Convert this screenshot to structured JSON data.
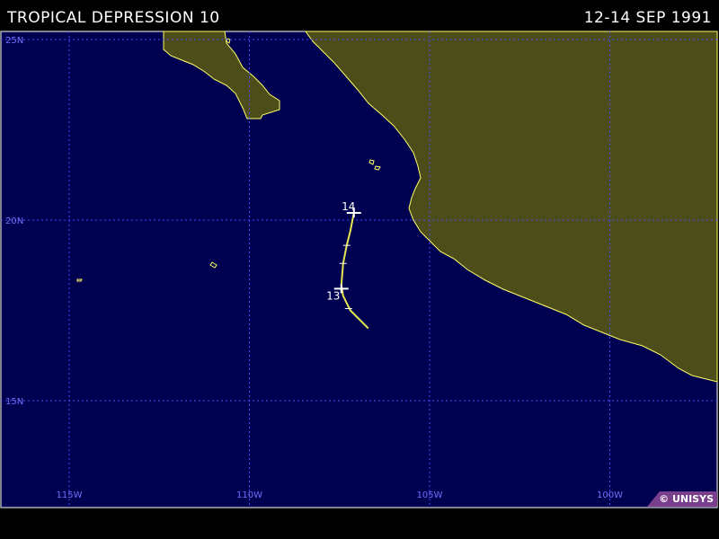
{
  "title_left": "TROPICAL DEPRESSION 10",
  "title_right": "12-14 SEP 1991",
  "credit": "© UNISYS",
  "colors": {
    "ocean": "#000050",
    "land": "#4d4d1a",
    "coastline": "#ffff66",
    "grid": "#4a4aff",
    "grid_labels": "#6f6fff",
    "track": "#e6e650",
    "marker": "#ffffff"
  },
  "map": {
    "lon_range": [
      -117,
      -97
    ],
    "lat_range": [
      10.5,
      25.3
    ],
    "gridlines": {
      "longitudes": [
        {
          "lon": -115,
          "label": "115W"
        },
        {
          "lon": -110,
          "label": "110W"
        },
        {
          "lon": -105,
          "label": "105W"
        },
        {
          "lon": -100,
          "label": "100W"
        }
      ],
      "latitudes": [
        {
          "lat": 25,
          "label": "25N"
        },
        {
          "lat": 20,
          "label": "20N"
        },
        {
          "lat": 15,
          "label": "15N"
        }
      ]
    }
  },
  "storm_track": {
    "points": [
      {
        "lon": -106.7,
        "lat": 17.0
      },
      {
        "lon": -107.2,
        "lat": 17.5
      },
      {
        "lon": -107.4,
        "lat": 17.9
      },
      {
        "lon": -107.45,
        "lat": 18.2
      },
      {
        "lon": -107.4,
        "lat": 18.8
      },
      {
        "lon": -107.3,
        "lat": 19.3
      },
      {
        "lon": -107.2,
        "lat": 19.7
      },
      {
        "lon": -107.1,
        "lat": 20.2
      }
    ],
    "day_markers": [
      {
        "label": "13",
        "lon": -107.45,
        "lat": 18.1
      },
      {
        "label": "14",
        "lon": -107.1,
        "lat": 20.2
      }
    ],
    "six_hour_ticks": [
      {
        "lon": -107.25,
        "lat": 17.55
      },
      {
        "lon": -107.4,
        "lat": 18.8
      },
      {
        "lon": -107.3,
        "lat": 19.3
      }
    ]
  }
}
